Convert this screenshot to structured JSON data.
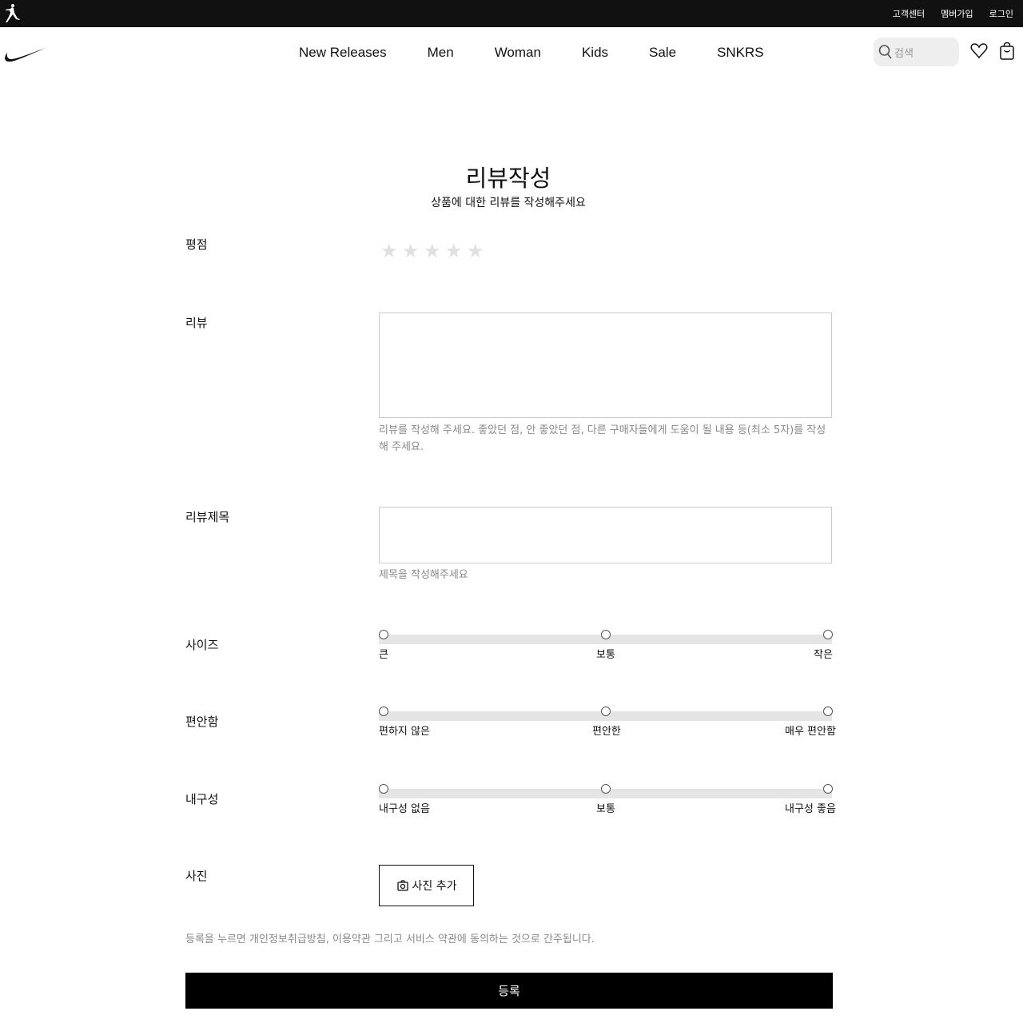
{
  "utility": {
    "links": [
      "고객센터",
      "멤버가입",
      "로그인"
    ]
  },
  "nav": {
    "items": [
      "New Releases",
      "Men",
      "Woman",
      "Kids",
      "Sale",
      "SNKRS"
    ]
  },
  "search": {
    "placeholder": "검색"
  },
  "page": {
    "title": "리뷰작성",
    "subtitle": "상품에 대한 리뷰를 작성해주세요"
  },
  "rating": {
    "label": "평점",
    "value": 0,
    "max": 5,
    "star_glyph": "★"
  },
  "review": {
    "label": "리뷰",
    "value": "",
    "help": "리뷰를 작성해 주세요. 좋았던 점, 안 좋았던 점, 다른 구매자들에게 도움이 될 내용 등(최소 5자)를 작성해 주세요."
  },
  "review_title": {
    "label": "리뷰제목",
    "value": "",
    "help": "제목을 작성해주세요"
  },
  "size": {
    "label": "사이즈",
    "options": [
      "큰",
      "보통",
      "작은"
    ]
  },
  "comfort": {
    "label": "편안함",
    "options": [
      "편하지 않은",
      "편안한",
      "매우 편안함"
    ]
  },
  "durability": {
    "label": "내구성",
    "options": [
      "내구성 없음",
      "보통",
      "내구성 좋음"
    ]
  },
  "photo": {
    "label": "사진",
    "button_label": "사진 추가"
  },
  "consent": "등록을 누르면 개인정보취급방침, 이용약관 그리고 서비스 약관에 동의하는 것으로 간주됩니다.",
  "submit_label": "등록",
  "colors": {
    "utility_bg": "#111111",
    "submit_bg": "#000000",
    "star_inactive": "#e0e0e0",
    "track": "#e5e5e5"
  }
}
